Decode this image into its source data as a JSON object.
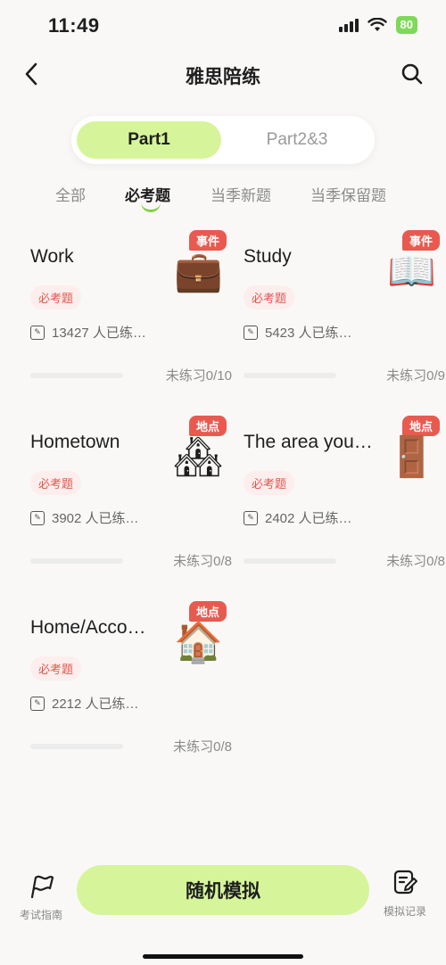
{
  "status": {
    "time": "11:49",
    "battery": "80"
  },
  "nav": {
    "title": "雅思陪练"
  },
  "segments": [
    {
      "label": "Part1",
      "active": true
    },
    {
      "label": "Part2&3",
      "active": false
    }
  ],
  "filters": [
    {
      "label": "全部",
      "active": false
    },
    {
      "label": "必考题",
      "active": true
    },
    {
      "label": "当季新题",
      "active": false
    },
    {
      "label": "当季保留题",
      "active": false
    }
  ],
  "cards": [
    {
      "title": "Work",
      "badge": "事件",
      "icon": "briefcase-icon",
      "emoji": "💼",
      "tag": "必考题",
      "stat": "13427 人已练…",
      "progress": 0,
      "progress_text": "未练习0/10"
    },
    {
      "title": "Study",
      "badge": "事件",
      "icon": "book-icon",
      "emoji": "📖",
      "tag": "必考题",
      "stat": "5423 人已练…",
      "progress": 0,
      "progress_text": "未练习0/9"
    },
    {
      "title": "Hometown",
      "badge": "地点",
      "icon": "houses-icon",
      "emoji": "🏘",
      "tag": "必考题",
      "stat": "3902 人已练…",
      "progress": 0,
      "progress_text": "未练习0/8"
    },
    {
      "title": "The area you…",
      "badge": "地点",
      "icon": "door-icon",
      "emoji": "🚪",
      "tag": "必考题",
      "stat": "2402 人已练…",
      "progress": 0,
      "progress_text": "未练习0/8"
    },
    {
      "title": "Home/Acco…",
      "badge": "地点",
      "icon": "house-icon",
      "emoji": "🏠",
      "tag": "必考题",
      "stat": "2212 人已练…",
      "progress": 0,
      "progress_text": "未练习0/8"
    }
  ],
  "bottom": {
    "guide_label": "考试指南",
    "random_label": "随机模拟",
    "record_label": "模拟记录"
  },
  "colors": {
    "accent_green": "#d6f59a",
    "badge_red": "#e85a4f",
    "tag_red": "#e2574c"
  }
}
